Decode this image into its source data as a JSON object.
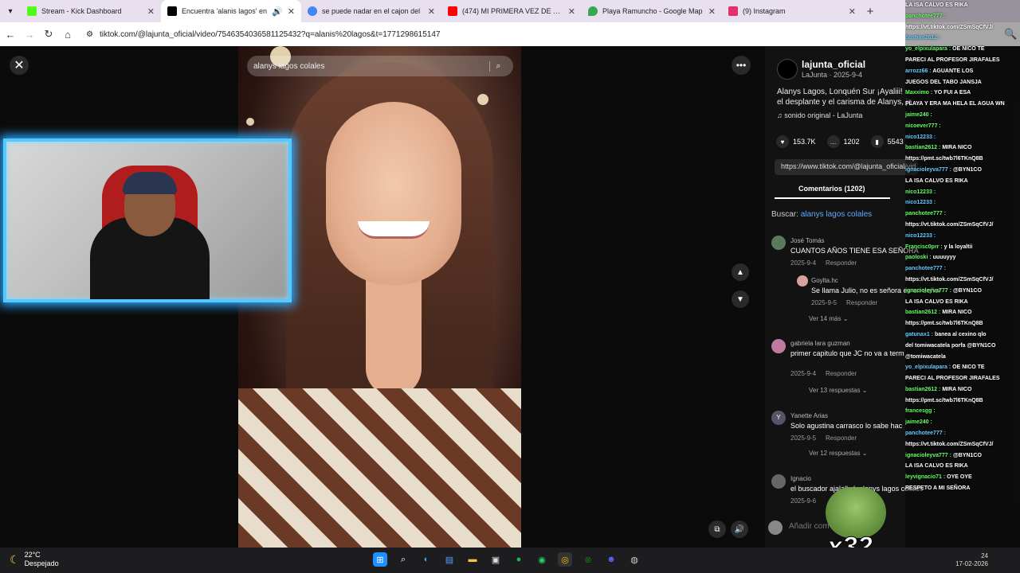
{
  "browser": {
    "tabs": [
      {
        "title": "Stream - Kick Dashboard",
        "color": "#53fc18"
      },
      {
        "title": "Encuentra 'alanis lagos' en",
        "color": "#000000",
        "active": true
      },
      {
        "title": "se puede nadar en el cajon del",
        "color": "#4285f4"
      },
      {
        "title": "(474) MI PRIMERA VEZ DE CAM",
        "color": "#ff0000"
      },
      {
        "title": "Playa Ramuncho - Google Map",
        "color": "#34a853"
      },
      {
        "title": "(9) Instagram",
        "color": "#e1306c"
      }
    ],
    "url": "tiktok.com/@lajunta_oficial/video/7546354036581125432?q=alanis%20lagos&t=1771298615147"
  },
  "video": {
    "search_query": "alanys lagos colales"
  },
  "post": {
    "username": "lajunta_oficial",
    "meta": "LaJunta · 2025-9-4",
    "caption": "Alanys Lagos, Lonquén Sur ¡Ayaliii! ... el desplante y el carisma de Alanys, ja",
    "sound": "sonido original - LaJunta",
    "likes": "153.7K",
    "comments": "1202",
    "saves": "5543",
    "link": "https://www.tiktok.com/@lajunta_oficial/vid",
    "comments_tab": "Comentarios (1202)",
    "search_label": "Buscar:",
    "search_term": "alanys lagos colales"
  },
  "comments": [
    {
      "name": "José Tomás",
      "text": "CUANTOS AÑOS TIENE ESA SEÑORA",
      "date": "2025-9-4",
      "reply": "Responder",
      "more": ""
    },
    {
      "name": "Goylta.hc",
      "text": "Se llama Julio, no es señora es un señor",
      "date": "2025-9-5",
      "reply": "Responder",
      "more": "Ver 14 más"
    },
    {
      "name": "gabriela lara guzman",
      "text": "primer capitulo que JC no va a term",
      "date": "2025-9-4",
      "reply": "Responder",
      "more": "Ver 13 respuestas"
    },
    {
      "name": "Yanette Arias",
      "text": "Solo agustina carrasco lo sabe hac",
      "date": "2025-9-5",
      "reply": "Responder",
      "more": "Ver 12 respuestas"
    },
    {
      "name": "Ignacio",
      "text": "el buscador ajalalksk alanys lagos colales",
      "date": "2025-9-6",
      "reply": "",
      "more": ""
    }
  ],
  "add_comment": "Añadir com",
  "chat": [
    {
      "user": "",
      "msg": "LA ISA CALVO ES RIKA"
    },
    {
      "user": "panchotee777 :",
      "msg": ""
    },
    {
      "user": "",
      "msg": "https://vt.tiktok.com/ZSmSqCfVJ/"
    },
    {
      "user": "bastian2612 :",
      "msg": ""
    },
    {
      "user": "yo_elpixulapara :",
      "msg": "OE NICO TE"
    },
    {
      "user": "",
      "msg": "PARECI AL PROFESOR JIRAFALES"
    },
    {
      "user": "arrozz66 :",
      "msg": "AGUANTE LOS"
    },
    {
      "user": "",
      "msg": "JUEGOS DEL TABO JANSJA"
    },
    {
      "user": "Maxximo :",
      "msg": "YO FUI A ESA"
    },
    {
      "user": "",
      "msg": "PLAYA Y ERA MA HELA EL AGUA WN"
    },
    {
      "user": "jaime240 :",
      "msg": ""
    },
    {
      "user": "nicoever777 :",
      "msg": ""
    },
    {
      "user": "nico12233 :",
      "msg": ""
    },
    {
      "user": "bastian2612 :",
      "msg": "MIRA NICO"
    },
    {
      "user": "",
      "msg": "https://pmt.sc/twb7l6TKnQ8B"
    },
    {
      "user": "ignacioleyva777 :",
      "msg": "@BYN1CO"
    },
    {
      "user": "",
      "msg": "LA ISA CALVO ES RIKA"
    },
    {
      "user": "nico12233 :",
      "msg": ""
    },
    {
      "user": "nico12233 :",
      "msg": ""
    },
    {
      "user": "panchotee777 :",
      "msg": ""
    },
    {
      "user": "",
      "msg": "https://vt.tiktok.com/ZSmSqCfVJ/"
    },
    {
      "user": "nico12233 :",
      "msg": ""
    },
    {
      "user": "Francisc0prr :",
      "msg": "y la loyaltii"
    },
    {
      "user": "paoloski :",
      "msg": "uuuuyyy"
    },
    {
      "user": "panchotee777 :",
      "msg": ""
    },
    {
      "user": "",
      "msg": "https://vt.tiktok.com/ZSmSqCfVJ/"
    },
    {
      "user": "ignacioleyva777 :",
      "msg": "@BYN1CO"
    },
    {
      "user": "",
      "msg": "LA ISA CALVO ES RIKA"
    },
    {
      "user": "bastian2612 :",
      "msg": "MIRA NICO"
    },
    {
      "user": "",
      "msg": "https://pmt.sc/twb7l6TKnQ8B"
    },
    {
      "user": "gatunax1 :",
      "msg": "banea al cexino qlo"
    },
    {
      "user": "",
      "msg": "del tomiwacatela porfa @BYN1CO"
    },
    {
      "user": "",
      "msg": "@tomiwacatela"
    },
    {
      "user": "yo_elpixulapara :",
      "msg": "OE NICO TE"
    },
    {
      "user": "",
      "msg": "PARECI AL PROFESOR JIRAFALES"
    },
    {
      "user": "bastian2612 :",
      "msg": "MIRA NICO"
    },
    {
      "user": "",
      "msg": "https://pmt.sc/twb7l6TKnQ8B"
    },
    {
      "user": "francesgg :",
      "msg": ""
    },
    {
      "user": "jaime240 :",
      "msg": ""
    },
    {
      "user": "panchotee777 :",
      "msg": ""
    },
    {
      "user": "",
      "msg": "https://vt.tiktok.com/ZSmSqCfVJ/"
    },
    {
      "user": "ignacioleyva777 :",
      "msg": "@BYN1CO"
    },
    {
      "user": "",
      "msg": "LA ISA CALVO ES RIKA"
    },
    {
      "user": "leyvignacio71 :",
      "msg": "OYE OYE"
    },
    {
      "user": "",
      "msg": "RESPETO A MI SEÑORA"
    }
  ],
  "overlay_multiplier": "x32",
  "taskbar": {
    "temp": "22°C",
    "weather": "Despejado",
    "time": "24",
    "date": "17-02-2026"
  }
}
